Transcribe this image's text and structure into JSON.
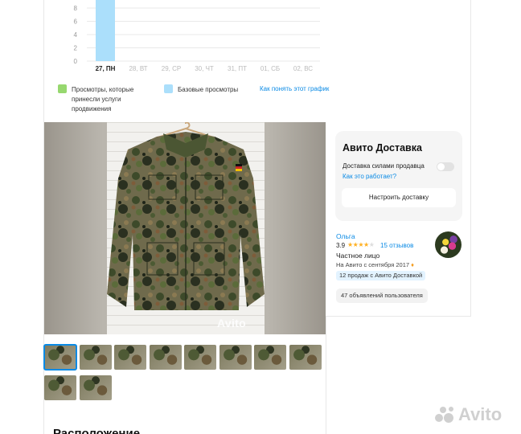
{
  "chart": {
    "y_ticks": [
      "8",
      "6",
      "4",
      "2",
      "0"
    ],
    "days": [
      "27, ПН",
      "28, ВТ",
      "29, СР",
      "30, ЧТ",
      "31, ПТ",
      "01, СБ",
      "02, ВС"
    ],
    "legend_paid": "Просмотры, которые принесли услуги продвижения",
    "legend_paid_lines": [
      "Просмотры, которые",
      "принесли услуги",
      "продвижения"
    ],
    "legend_base": "Базовые просмотры",
    "legend_link": "Как понять этот график",
    "colors": {
      "paid": "#97d86f",
      "base": "#abdffb",
      "grid": "#e9e9e9"
    }
  },
  "chart_data": {
    "type": "bar",
    "categories": [
      "27, ПН",
      "28, ВТ",
      "29, СР",
      "30, ЧТ",
      "31, ПТ",
      "01, СБ",
      "02, ВС"
    ],
    "series": [
      {
        "name": "Просмотры, которые принесли услуги продвижения",
        "values": [
          0,
          0,
          0,
          0,
          0,
          0,
          0
        ]
      },
      {
        "name": "Базовые просмотры",
        "values": [
          10,
          0,
          0,
          0,
          0,
          0,
          0
        ]
      }
    ],
    "ylim": [
      0,
      10
    ],
    "yticks": [
      0,
      2,
      4,
      6,
      8
    ],
    "grid": true,
    "legend_position": "bottom"
  },
  "gallery": {
    "watermark": "Avito",
    "thumb_count": 10,
    "selected_index": 0
  },
  "section_heading": "Расположение",
  "delivery": {
    "title": "Авито Доставка",
    "option_label": "Доставка силами продавца",
    "option_enabled": false,
    "how_link": "Как это работает?",
    "setup_button": "Настроить доставку"
  },
  "seller": {
    "name": "Ольга",
    "rating": "3.9",
    "stars_filled": 4,
    "stars_total": 5,
    "reviews": "15 отзывов",
    "type": "Частное лицо",
    "since": "На Авито с сентября 2017",
    "sales_badge": "12 продаж с Авито Доставкой",
    "listings_button": "47 объявлений пользователя"
  },
  "corner_logo": "Avito"
}
